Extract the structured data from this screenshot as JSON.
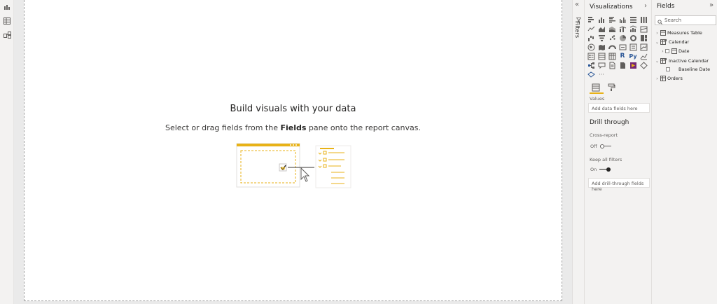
{
  "left_rail": {
    "icons": [
      "report-view-icon",
      "data-view-icon",
      "model-view-icon"
    ]
  },
  "canvas": {
    "empty_title": "Build visuals with your data",
    "empty_sub_before": "Select or drag fields from the",
    "empty_sub_bold": "Fields",
    "empty_sub_after": "pane onto the report canvas."
  },
  "filters": {
    "label": "Filters",
    "collapse_glyph": "«"
  },
  "visualizations": {
    "title": "Visualizations",
    "collapse_glyph": "›",
    "accent_color": "#e8b217",
    "values_label": "Values",
    "values_placeholder": "Add data fields here",
    "drill_title": "Drill through",
    "cross_report_label": "Cross-report",
    "cross_report_state": "Off",
    "keep_filters_label": "Keep all filters",
    "keep_filters_state": "On",
    "drill_placeholder": "Add drill-through fields here",
    "more_glyph": "···"
  },
  "fields": {
    "title": "Fields",
    "collapse_glyph": "»",
    "search_placeholder": "Search",
    "tree": [
      {
        "label": "Measures Table"
      },
      {
        "label": "Calendar"
      },
      {
        "label": "Date"
      },
      {
        "label": "Inactive Calendar"
      },
      {
        "label": "Baseline Date"
      },
      {
        "label": "Orders"
      }
    ]
  }
}
